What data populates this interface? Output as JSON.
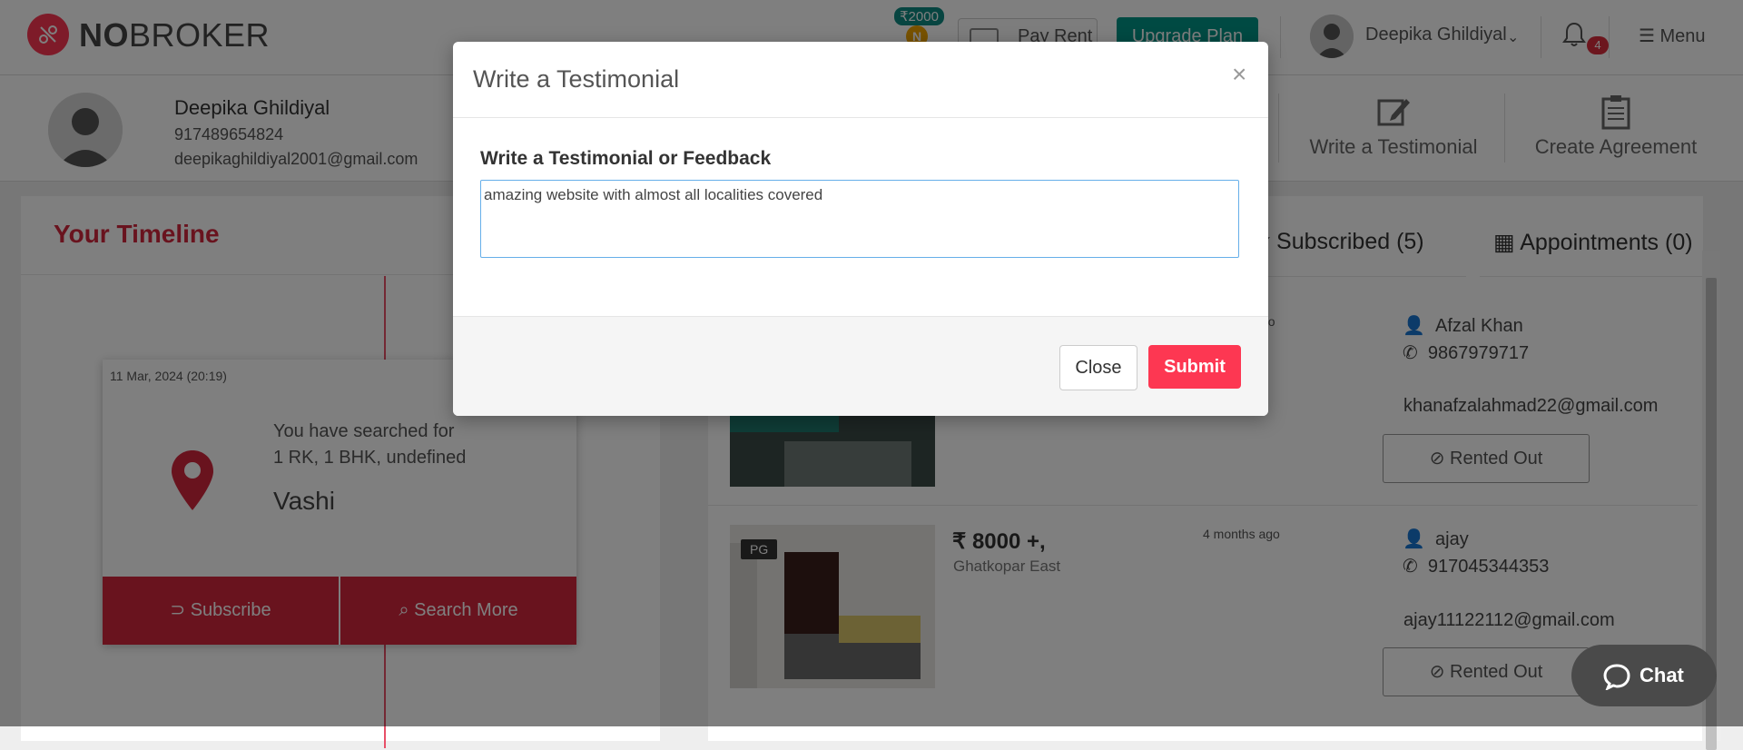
{
  "header": {
    "logo_prefix": "NO",
    "logo_suffix": "BROKER",
    "coin_amount": "₹2000",
    "coin_letter": "N",
    "pay_rent_label": "Pay Rent",
    "upgrade_label": "Upgrade Plan",
    "user_name": "Deepika Ghildiyal",
    "notification_count": "4",
    "menu_label": "Menu"
  },
  "profile": {
    "name": "Deepika Ghildiyal",
    "phone": "917489654824",
    "email": "deepikaghildiyal2001@gmail.com",
    "actions": [
      {
        "label": "Write a Testimonial",
        "icon": "pencil-square-icon"
      },
      {
        "label": "Create Agreement",
        "icon": "clipboard-icon"
      }
    ]
  },
  "timeline": {
    "title": "Your Timeline",
    "card": {
      "date": "11 Mar, 2024 (20:19)",
      "line1": "You have searched for",
      "line2": "1 RK, 1 BHK, undefined",
      "city": "Vashi",
      "subscribe_label": "Subscribe",
      "search_more_label": "Search More"
    }
  },
  "tabs": {
    "subscribed": "Subscribed (5)",
    "appointments": "Appointments (0)"
  },
  "listings": [
    {
      "ago": "go",
      "owner": "Afzal Khan",
      "phone": "9867979717",
      "email": "khanafzalahmad22@gmail.com",
      "status": "Rented Out"
    },
    {
      "tag": "PG",
      "price": "₹ 8000 +,",
      "locality": "Ghatkopar East",
      "ago": "4 months ago",
      "owner": "ajay",
      "phone": "917045344353",
      "email": "ajay11122112@gmail.com",
      "status": "Rented Out"
    }
  ],
  "modal": {
    "title": "Write a Testimonial",
    "close_symbol": "×",
    "label": "Write a Testimonial or Feedback",
    "textarea_value": "amazing website with almost all localities covered",
    "close_button": "Close",
    "submit_button": "Submit"
  },
  "chat": {
    "label": "Chat"
  },
  "colors": {
    "brand": "#fd3752",
    "timeline_red": "#d3263d",
    "upgrade_green": "#009587",
    "focus_blue": "#66afe9"
  }
}
